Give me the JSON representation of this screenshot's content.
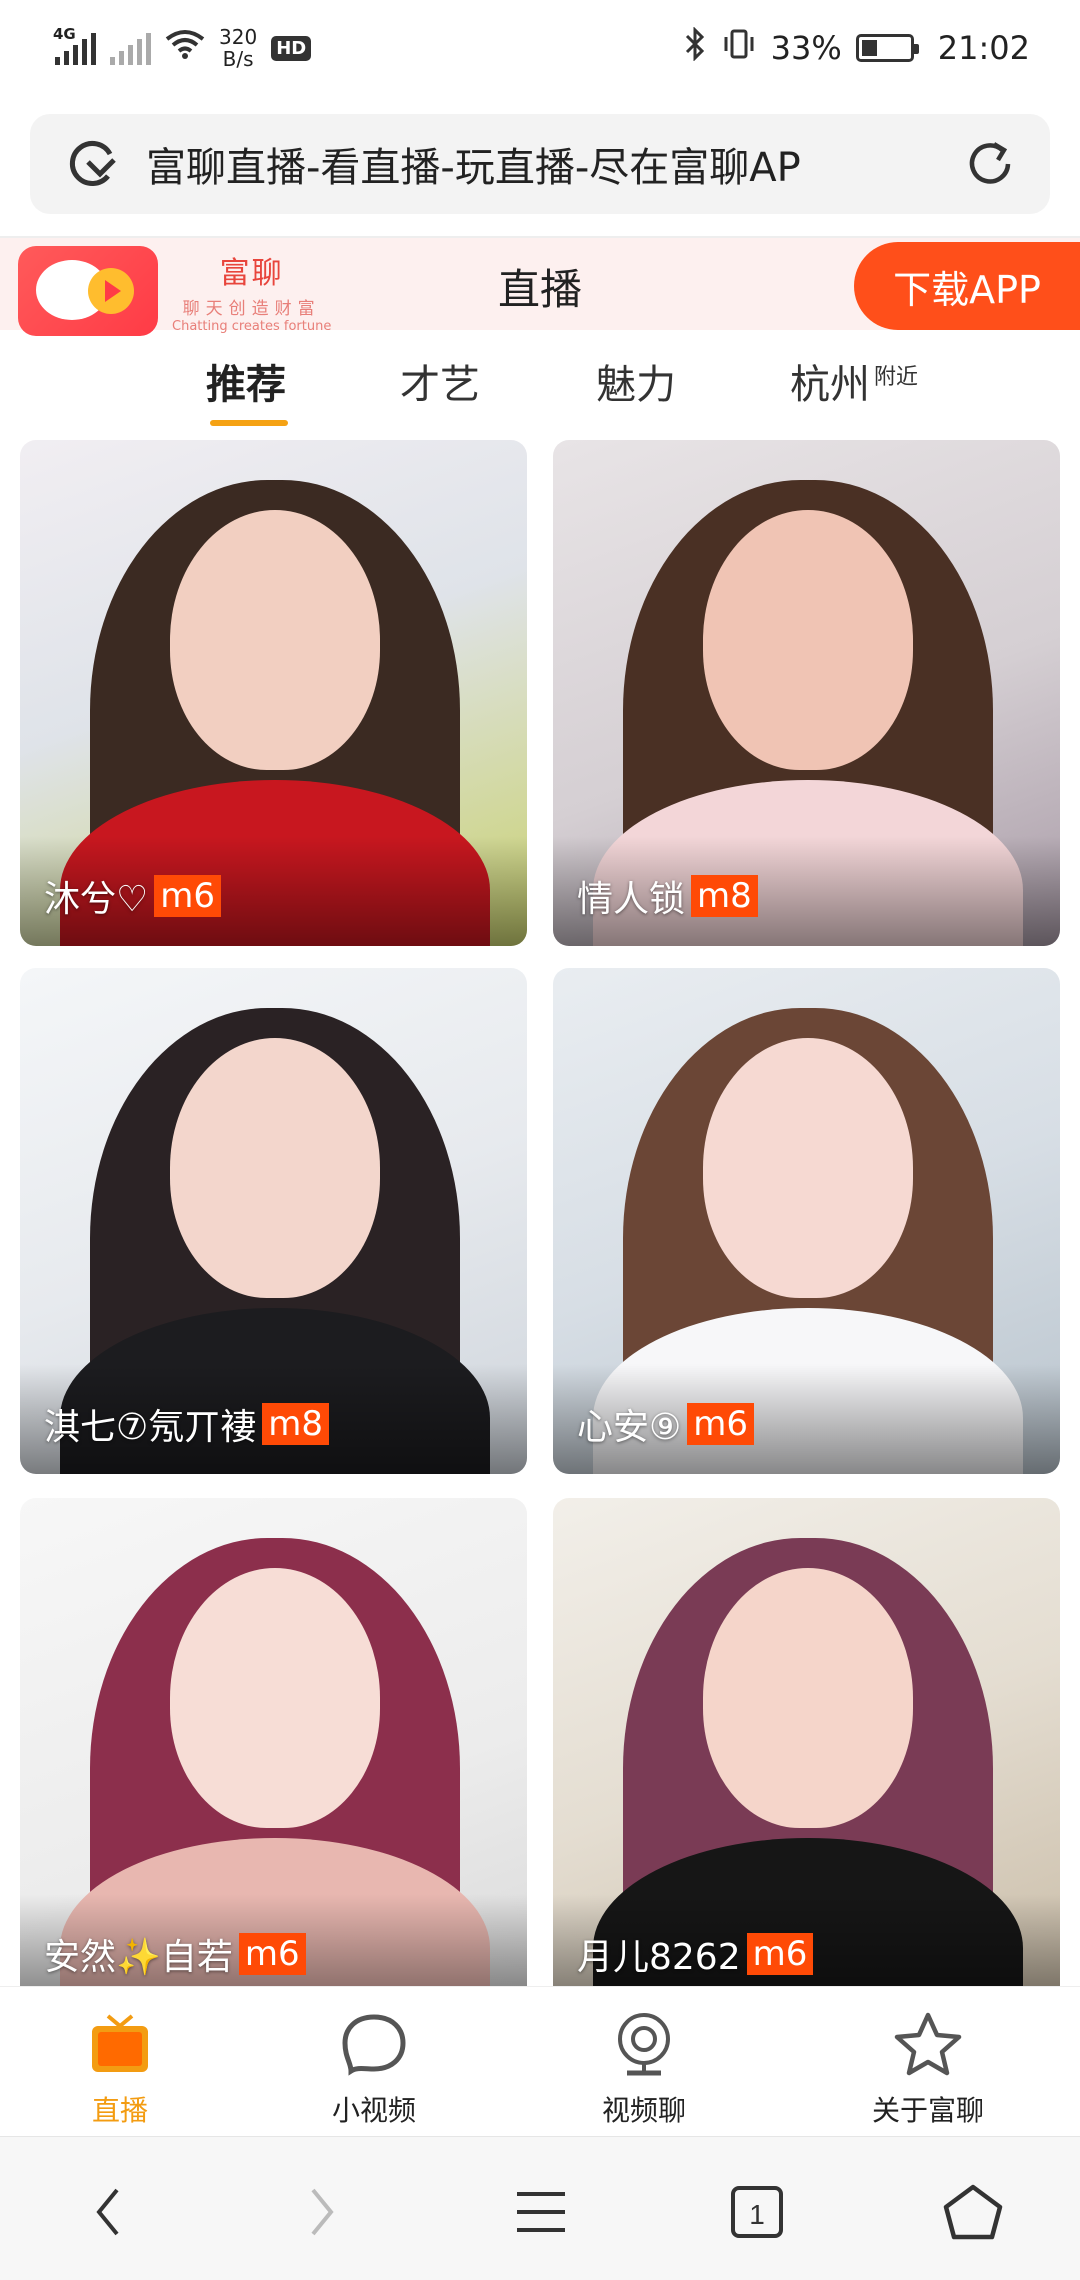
{
  "status_bar": {
    "network": "4G",
    "speed_value": "320",
    "speed_unit": "B/s",
    "hd": "HD",
    "battery": "33%",
    "time": "21:02"
  },
  "browser": {
    "page_title": "富聊直播-看直播-玩直播-尽在富聊AP"
  },
  "site_header": {
    "logo_name": "富聊",
    "logo_slogan": "聊天创造财富",
    "logo_english": "Chatting creates fortune",
    "title": "直播",
    "download_label": "下载APP"
  },
  "tabs": [
    {
      "label": "推荐",
      "sub": ""
    },
    {
      "label": "才艺",
      "sub": ""
    },
    {
      "label": "魅力",
      "sub": ""
    },
    {
      "label": "杭州",
      "sub": "附近"
    }
  ],
  "streams": [
    {
      "name": "沐兮♡",
      "level": "m6"
    },
    {
      "name": "情人锁",
      "level": "m8"
    },
    {
      "name": "淇七⑦氖丌褄",
      "level": "m8"
    },
    {
      "name": "心安⑨",
      "level": "m6"
    },
    {
      "name": "安然✨自若",
      "level": "m6"
    },
    {
      "name": "月儿8262",
      "level": "m6"
    }
  ],
  "bottom_nav": [
    {
      "label": "直播",
      "icon": "tv-icon"
    },
    {
      "label": "小视频",
      "icon": "speech-bubble-icon"
    },
    {
      "label": "视频聊",
      "icon": "camera-icon"
    },
    {
      "label": "关于富聊",
      "icon": "star-icon"
    }
  ],
  "colors": {
    "accent_orange": "#f39c12",
    "download_button": "#ff4f1a",
    "level_badge": "#ff4a06",
    "brand_red": "#e8453c"
  }
}
